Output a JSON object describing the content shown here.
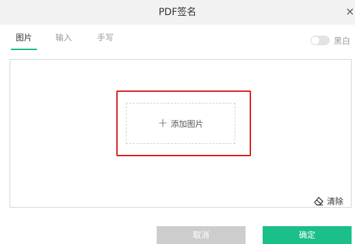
{
  "dialog": {
    "title": "PDF签名",
    "close_glyph": "×"
  },
  "tabs": [
    {
      "label": "图片",
      "active": true
    },
    {
      "label": "输入",
      "active": false
    },
    {
      "label": "手写",
      "active": false
    }
  ],
  "toggle": {
    "label": "黑白",
    "on": false
  },
  "upload": {
    "label": "添加图片",
    "icon": "plus-icon"
  },
  "clear": {
    "label": "清除",
    "icon": "eraser-icon"
  },
  "buttons": {
    "cancel": "取消",
    "confirm": "确定"
  },
  "colors": {
    "accent": "#10b981",
    "confirm": "#1abf89",
    "cancel": "#cdcdcd",
    "highlight": "#d9191d"
  }
}
